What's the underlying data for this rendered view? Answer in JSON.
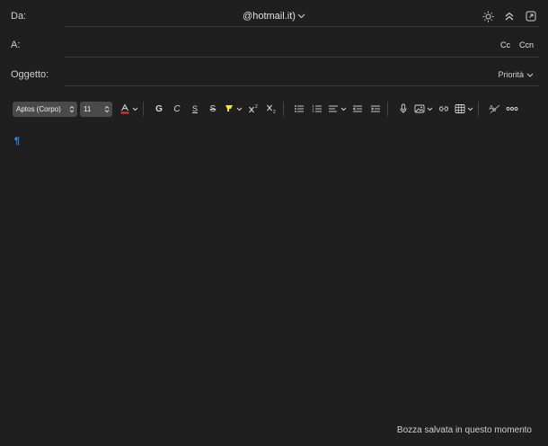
{
  "header": {
    "from_label": "Da:",
    "from_account": "@hotmail.it)",
    "to_label": "A:",
    "cc_label": "Cc",
    "bcc_label": "Ccn",
    "subject_label": "Oggetto:",
    "priority_label": "Priorità"
  },
  "toolbar": {
    "font_name": "Aptos (Corpo)",
    "font_size": "11",
    "bold": "G",
    "italic": "C",
    "underline": "S",
    "strike": "S"
  },
  "icons": {
    "theme": "sun-icon",
    "collapse": "double-chevron-up-icon",
    "popout": "popout-icon"
  },
  "colors": {
    "font_color": "#e0382f",
    "highlight": "#f5e23a",
    "cursor_mark": "#2d8cf0"
  },
  "body": {
    "paragraph_mark": "¶"
  },
  "status": {
    "draft": "Bozza salvata in questo momento"
  }
}
